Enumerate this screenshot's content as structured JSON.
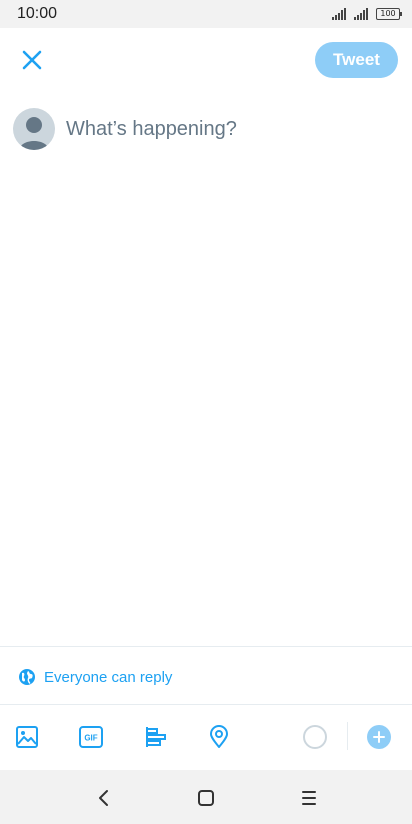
{
  "status_bar": {
    "time": "10:00",
    "battery_level": "100",
    "icons": [
      "signal-icon",
      "signal-icon",
      "battery-icon"
    ]
  },
  "header": {
    "close_icon": "close-icon",
    "tweet_label": "Tweet"
  },
  "compose": {
    "avatar_icon": "default-avatar-icon",
    "placeholder": "What’s happening?",
    "value": ""
  },
  "reply_setting": {
    "icon": "globe-icon",
    "label": "Everyone can reply"
  },
  "toolbar": {
    "items": [
      "image-icon",
      "gif-icon",
      "poll-icon",
      "location-icon"
    ],
    "add_icon": "plus-icon"
  },
  "nav_bar": {
    "items": [
      "back-icon",
      "home-icon",
      "menu-icon"
    ]
  },
  "colors": {
    "accent": "#1da1f2",
    "tweet_button_disabled": "#8ecdf7",
    "placeholder": "#657786",
    "avatar_bg": "#ccd6dd",
    "system_bar_bg": "#f2f2f2"
  }
}
